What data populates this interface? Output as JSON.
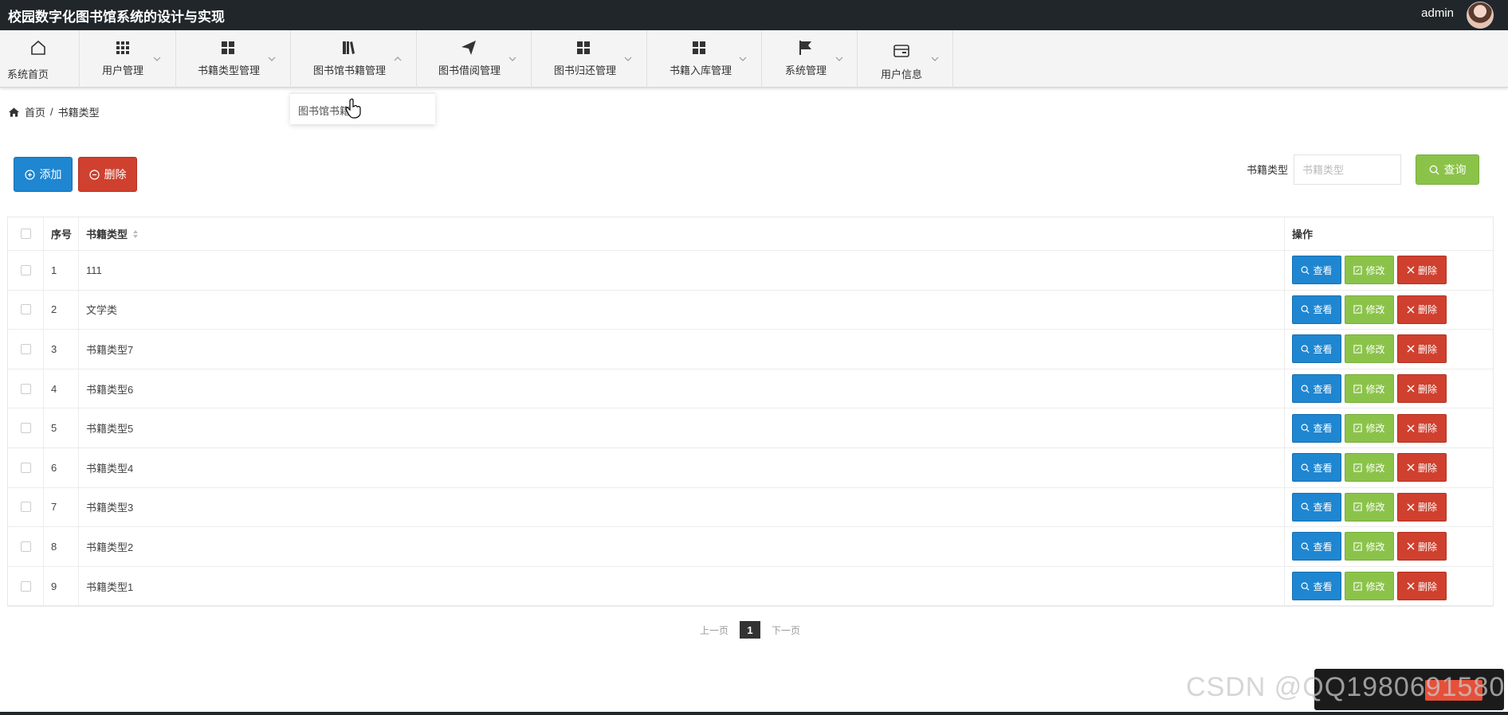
{
  "app": {
    "title": "校园数字化图书馆系统的设计与实现",
    "user": "admin"
  },
  "nav": {
    "items": [
      {
        "label": "系统首页",
        "icon": "home-icon"
      },
      {
        "label": "用户管理",
        "icon": "grid-icon"
      },
      {
        "label": "书籍类型管理",
        "icon": "apps-icon"
      },
      {
        "label": "图书馆书籍管理",
        "icon": "book-icon"
      },
      {
        "label": "图书借阅管理",
        "icon": "send-icon"
      },
      {
        "label": "图书归还管理",
        "icon": "apps-icon"
      },
      {
        "label": "书籍入库管理",
        "icon": "apps-icon"
      },
      {
        "label": "系统管理",
        "icon": "flag-icon"
      },
      {
        "label": "用户信息",
        "icon": "card-icon"
      }
    ],
    "dropdown": {
      "item": "图书馆书籍"
    }
  },
  "breadcrumb": {
    "home": "首页",
    "separator": "/",
    "current": "书籍类型"
  },
  "toolbar": {
    "add": "添加",
    "delete": "删除",
    "search_label": "书籍类型",
    "search_placeholder": "书籍类型",
    "query": "查询"
  },
  "table": {
    "headers": {
      "index": "序号",
      "type": "书籍类型",
      "ops": "操作"
    },
    "ops": {
      "view": "查看",
      "edit": "修改",
      "delete": "删除"
    },
    "rows": [
      {
        "index": "1",
        "type": "111"
      },
      {
        "index": "2",
        "type": "文学类"
      },
      {
        "index": "3",
        "type": "书籍类型7"
      },
      {
        "index": "4",
        "type": "书籍类型6"
      },
      {
        "index": "5",
        "type": "书籍类型5"
      },
      {
        "index": "6",
        "type": "书籍类型4"
      },
      {
        "index": "7",
        "type": "书籍类型3"
      },
      {
        "index": "8",
        "type": "书籍类型2"
      },
      {
        "index": "9",
        "type": "书籍类型1"
      }
    ]
  },
  "pagination": {
    "prev": "上一页",
    "current": "1",
    "next": "下一页"
  },
  "watermark": {
    "text": "CSDN @QQ1980691580"
  },
  "colors": {
    "primary": "#1f86d1",
    "success": "#8bc34a",
    "danger": "#d0402e",
    "topbar": "#20262a"
  }
}
